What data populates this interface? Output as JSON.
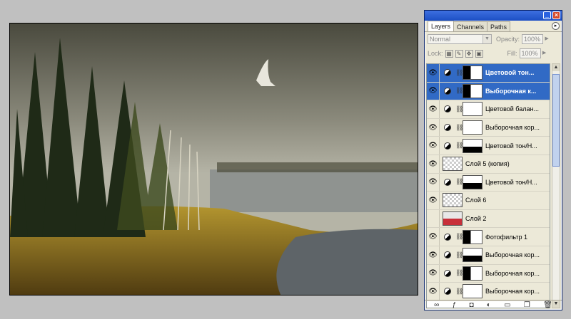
{
  "panel": {
    "tabs": [
      "Layers",
      "Channels",
      "Paths"
    ],
    "blend_mode": "Normal",
    "opacity_label": "Opacity:",
    "opacity_value": "100%",
    "lock_label": "Lock:",
    "fill_label": "Fill:",
    "fill_value": "100%",
    "layers": [
      {
        "name": "Цветовой тон...",
        "visible": true,
        "selected": true,
        "type": "adjustment",
        "mask": "dark"
      },
      {
        "name": "Выборочная к...",
        "visible": true,
        "selected": true,
        "type": "adjustment",
        "mask": "dark"
      },
      {
        "name": "Цветовой балан...",
        "visible": true,
        "selected": false,
        "type": "adjustment",
        "mask": "white"
      },
      {
        "name": "Выборочная кор...",
        "visible": true,
        "selected": false,
        "type": "adjustment",
        "mask": "white"
      },
      {
        "name": "Цветовой тон/Н...",
        "visible": true,
        "selected": false,
        "type": "adjustment",
        "mask": "mixed"
      },
      {
        "name": "Слой 5 (копия)",
        "visible": true,
        "selected": false,
        "type": "pixel",
        "thumb": "checker"
      },
      {
        "name": "Цветовой тон/Н...",
        "visible": true,
        "selected": false,
        "type": "adjustment",
        "mask": "mixed"
      },
      {
        "name": "Слой 6",
        "visible": true,
        "selected": false,
        "type": "pixel",
        "thumb": "checker"
      },
      {
        "name": "Слой 2",
        "visible": false,
        "selected": false,
        "type": "pixel",
        "thumb": "red"
      },
      {
        "name": "Фотофильтр 1",
        "visible": true,
        "selected": false,
        "type": "adjustment",
        "mask": "dark"
      },
      {
        "name": "Выборочная кор...",
        "visible": true,
        "selected": false,
        "type": "adjustment",
        "mask": "mixed"
      },
      {
        "name": "Выборочная кор...",
        "visible": true,
        "selected": false,
        "type": "adjustment",
        "mask": "dark"
      },
      {
        "name": "Выборочная кор...",
        "visible": true,
        "selected": false,
        "type": "adjustment",
        "mask": "white"
      }
    ]
  }
}
